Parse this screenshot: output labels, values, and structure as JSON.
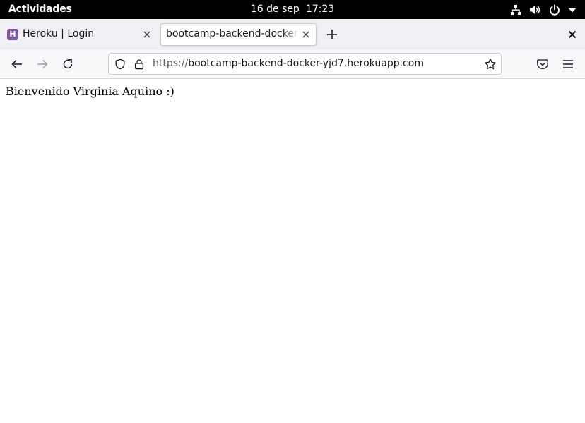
{
  "system_bar": {
    "activities_label": "Actividades",
    "date": "16 de sep",
    "time": "17:23",
    "icons": [
      "network-icon",
      "volume-icon",
      "power-icon",
      "chevron-down-icon"
    ]
  },
  "tabs": [
    {
      "title": "Heroku | Login",
      "favicon_letter": "H",
      "favicon_color": "#79589f",
      "active": false
    },
    {
      "title": "bootcamp-backend-docker-yjd7.herokuapp.com",
      "active": true
    }
  ],
  "toolbar": {
    "url_scheme": "https://",
    "url_host": "bootcamp-backend-docker-yjd7.herokuapp.com"
  },
  "page": {
    "greeting": "Bienvenido Virginia Aquino :)"
  },
  "colors": {
    "top_bar": "#000000",
    "tab_strip": "#f0f0f4",
    "toolbar": "#f9f9fb",
    "heroku_purple": "#79589f"
  }
}
